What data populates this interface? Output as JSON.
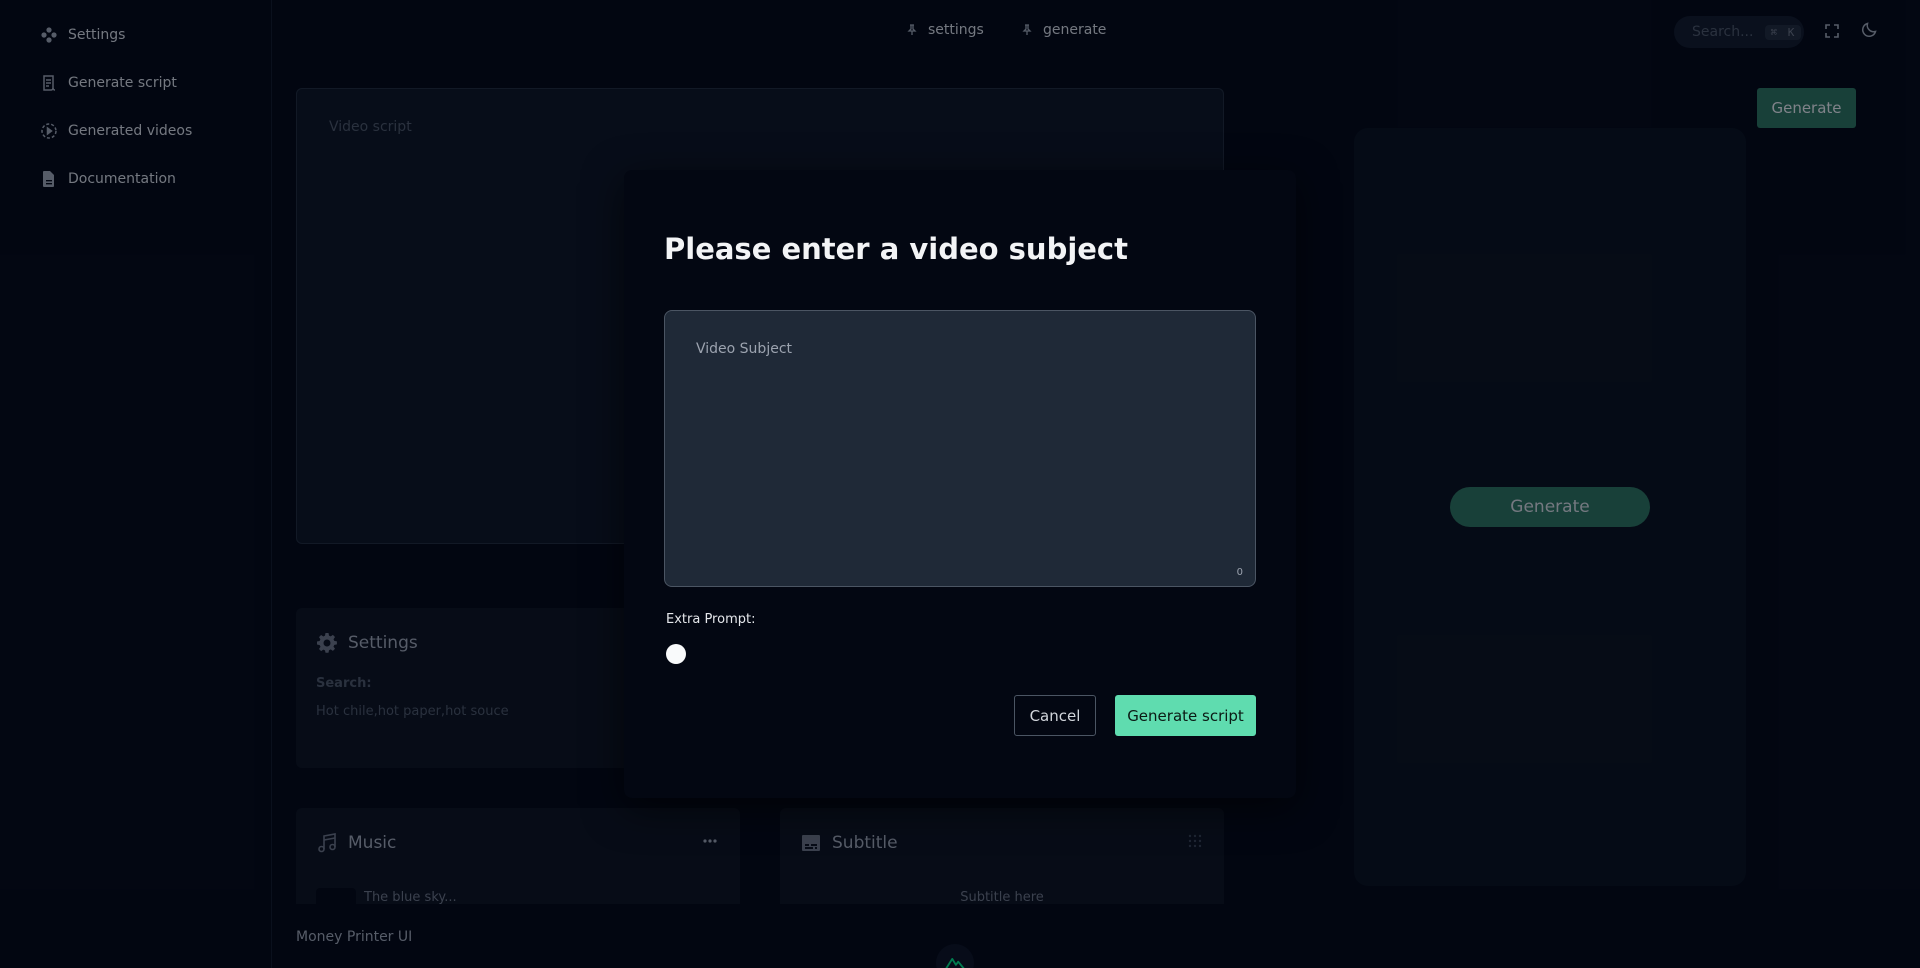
{
  "sidebar": {
    "items": [
      {
        "label": "Settings",
        "icon": "gamepad-icon"
      },
      {
        "label": "Generate script",
        "icon": "script-icon"
      },
      {
        "label": "Generated videos",
        "icon": "play-circle-icon"
      },
      {
        "label": "Documentation",
        "icon": "document-icon"
      }
    ]
  },
  "topbar": {
    "links": [
      {
        "label": "settings",
        "icon": "pin-icon"
      },
      {
        "label": "generate",
        "icon": "pin-icon"
      }
    ],
    "search_placeholder": "Search...",
    "search_shortcut": "⌘ K",
    "icons": [
      "fullscreen-icon",
      "moon-icon"
    ]
  },
  "main": {
    "script_placeholder": "Video script",
    "generate_top_label": "Generate",
    "generate_preview_label": "Generate",
    "settings_card": {
      "title": "Settings",
      "search_label": "Search:",
      "search_value": "Hot chile,hot paper,hot souce"
    },
    "music_card": {
      "title": "Music",
      "track": "The blue sky..."
    },
    "subtitle_card": {
      "title": "Subtitle",
      "placeholder": "Subtitle here"
    }
  },
  "footer": {
    "text": "Money Printer UI"
  },
  "modal": {
    "title": "Please enter a video subject",
    "textarea_placeholder": "Video Subject",
    "char_count": "0",
    "extra_prompt_label": "Extra Prompt:",
    "extra_prompt_enabled": false,
    "cancel_label": "Cancel",
    "submit_label": "Generate script"
  },
  "colors": {
    "background": "#030712",
    "accent": "#5fdcaf",
    "accent_muted": "#2b7059"
  }
}
